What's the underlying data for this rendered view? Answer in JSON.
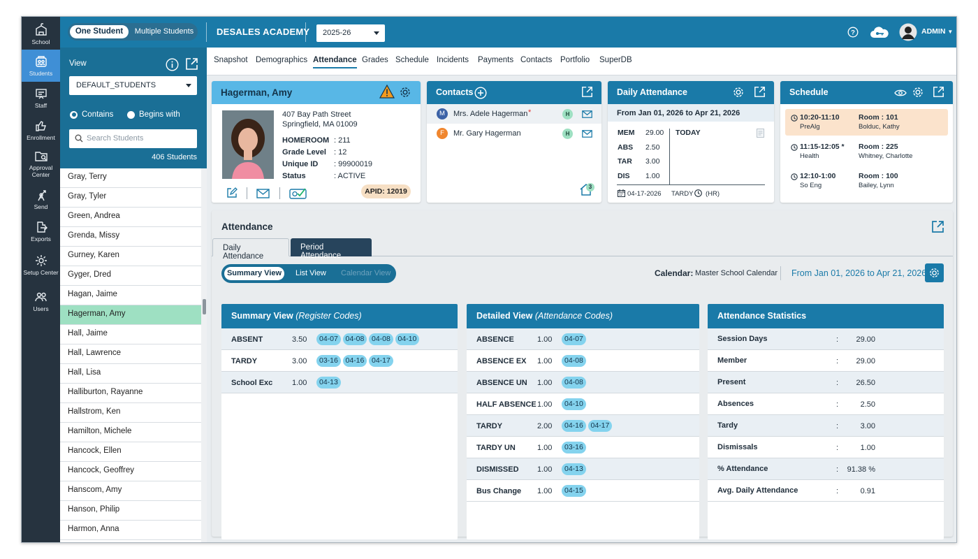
{
  "rail": [
    {
      "label": "School",
      "icon": "school-icon"
    },
    {
      "label": "Students",
      "icon": "students-icon",
      "active": true
    },
    {
      "label": "Staff",
      "icon": "staff-icon"
    },
    {
      "label": "Enrollment",
      "icon": "enrollment-icon"
    },
    {
      "label": "Approval Center",
      "icon": "approval-icon"
    },
    {
      "label": "Send",
      "icon": "send-icon"
    },
    {
      "label": "Exports",
      "icon": "exports-icon"
    },
    {
      "label": "Setup Center",
      "icon": "setup-icon"
    },
    {
      "label": "Users",
      "icon": "users-icon"
    }
  ],
  "topbar": {
    "mode_on": "One Student",
    "mode_off": "Multiple Students",
    "school": "DESALES ACADEMY",
    "year": "2025-26",
    "user": "ADMIN"
  },
  "student_panel": {
    "view_label": "View",
    "view_value": "DEFAULT_STUDENTS",
    "radio_contains": "Contains",
    "radio_begins": "Begins with",
    "search_placeholder": "Search Students",
    "count": "406 Students"
  },
  "students": [
    "Gray, Terry",
    "Gray, Tyler",
    "Green, Andrea",
    "Grenda, Missy",
    "Gurney, Karen",
    "Gyger, Dred",
    "Hagan, Jaime",
    "Hagerman, Amy",
    "Hall, Jaime",
    "Hall, Lawrence",
    "Hall, Lisa",
    "Halliburton, Rayanne",
    "Hallstrom, Ken",
    "Hamilton, Michele",
    "Hancock, Ellen",
    "Hancock, Geoffrey",
    "Hanscom, Amy",
    "Hanson, Philip",
    "Harmon, Anna"
  ],
  "selected_student": "Hagerman, Amy",
  "subnav": [
    "Snapshot",
    "Demographics",
    "Attendance",
    "Grades",
    "Schedule",
    "Incidents",
    "Payments",
    "Contacts",
    "Portfolio",
    "SuperDB"
  ],
  "subnav_active": "Attendance",
  "student_card": {
    "name": "Hagerman, Amy",
    "addr1": "407 Bay Path Street",
    "addr2": "Springfield, MA 01009",
    "fields": [
      {
        "k": "HOMEROOM",
        "v": ": 211"
      },
      {
        "k": "Grade Level",
        "v": ": 12"
      },
      {
        "k": "Unique ID",
        "v": ": 99900019"
      },
      {
        "k": "Status",
        "v": ": ACTIVE"
      }
    ],
    "apid": "APID: 12019"
  },
  "contacts_card": {
    "title": "Contacts",
    "items": [
      {
        "initial": "M",
        "name": "Mrs. Adele Hagerman",
        "star": "*",
        "badge": "H",
        "color": "#3c62a6"
      },
      {
        "initial": "F",
        "name": "Mr. Gary Hagerman",
        "star": "",
        "badge": "H",
        "color": "#f0862e"
      }
    ],
    "home_count": "3"
  },
  "daily_card": {
    "title": "Daily Attendance",
    "range": "From Jan 01, 2026 to Apr 21, 2026",
    "stats": [
      {
        "k": "MEM",
        "v": "29.00"
      },
      {
        "k": "ABS",
        "v": "2.50"
      },
      {
        "k": "TAR",
        "v": "3.00"
      },
      {
        "k": "DIS",
        "v": "1.00"
      }
    ],
    "today": "TODAY",
    "date": "04-17-2026",
    "code": "TARDY",
    "hr": "(HR)"
  },
  "schedule_card": {
    "title": "Schedule",
    "items": [
      {
        "time": "10:20-11:10",
        "course": "PreAlg",
        "room": "Room : 101",
        "teacher": "Bolduc, Kathy",
        "highlight": true
      },
      {
        "time": "11:15-12:05 *",
        "course": "Health",
        "room": "Room : 225",
        "teacher": "Whitney, Charlotte",
        "highlight": false
      },
      {
        "time": "12:10-1:00",
        "course": "So Eng",
        "room": "Room : 100",
        "teacher": "Bailey, Lynn",
        "highlight": false
      }
    ]
  },
  "attendance": {
    "title": "Attendance",
    "tab_daily": "Daily Attendance",
    "tab_period": "Period Attendance",
    "view_summary": "Summary View",
    "view_list": "List View",
    "view_calendar": "Calendar View",
    "calendar_label": "Calendar:",
    "calendar_value": "Master School Calendar",
    "range": "From Jan 01, 2026 to Apr 21, 2026",
    "summary": {
      "title": "Summary View",
      "subtitle": "(Register Codes)",
      "rows": [
        {
          "label": "ABSENT",
          "value": "3.50",
          "dates": [
            "04-07",
            "04-08",
            "04-08",
            "04-10"
          ]
        },
        {
          "label": "TARDY",
          "value": "3.00",
          "dates": [
            "03-16",
            "04-16",
            "04-17"
          ]
        },
        {
          "label": "School Exc",
          "value": "1.00",
          "dates": [
            "04-13"
          ]
        }
      ]
    },
    "detailed": {
      "title": "Detailed View",
      "subtitle": "(Attendance Codes)",
      "rows": [
        {
          "label": "ABSENCE",
          "value": "1.00",
          "dates": [
            "04-07"
          ]
        },
        {
          "label": "ABSENCE EX",
          "value": "1.00",
          "dates": [
            "04-08"
          ]
        },
        {
          "label": "ABSENCE UN",
          "value": "1.00",
          "dates": [
            "04-08"
          ]
        },
        {
          "label": "HALF ABSENCE",
          "value": "1.00",
          "dates": [
            "04-10"
          ]
        },
        {
          "label": "TARDY",
          "value": "2.00",
          "dates": [
            "04-16",
            "04-17"
          ]
        },
        {
          "label": "TARDY UN",
          "value": "1.00",
          "dates": [
            "03-16"
          ]
        },
        {
          "label": "DISMISSED",
          "value": "1.00",
          "dates": [
            "04-13"
          ]
        },
        {
          "label": "Bus Change",
          "value": "1.00",
          "dates": [
            "04-15"
          ]
        }
      ]
    },
    "stats": {
      "title": "Attendance Statistics",
      "rows": [
        {
          "label": "Session Days",
          "value": "29.00"
        },
        {
          "label": "Member",
          "value": "29.00"
        },
        {
          "label": "Present",
          "value": "26.50"
        },
        {
          "label": "Absences",
          "value": "2.50"
        },
        {
          "label": "Tardy",
          "value": "3.00"
        },
        {
          "label": "Dismissals",
          "value": "1.00"
        },
        {
          "label": "% Attendance",
          "value": "91.38 %"
        },
        {
          "label": "Avg. Daily Attendance",
          "value": "0.91"
        }
      ]
    }
  },
  "colors": {
    "primary": "#1a7aa8",
    "rail": "#26333f",
    "selected_row": "#9ee0c2",
    "chip": "#84d3ee",
    "highlight": "#fbe3cc"
  }
}
